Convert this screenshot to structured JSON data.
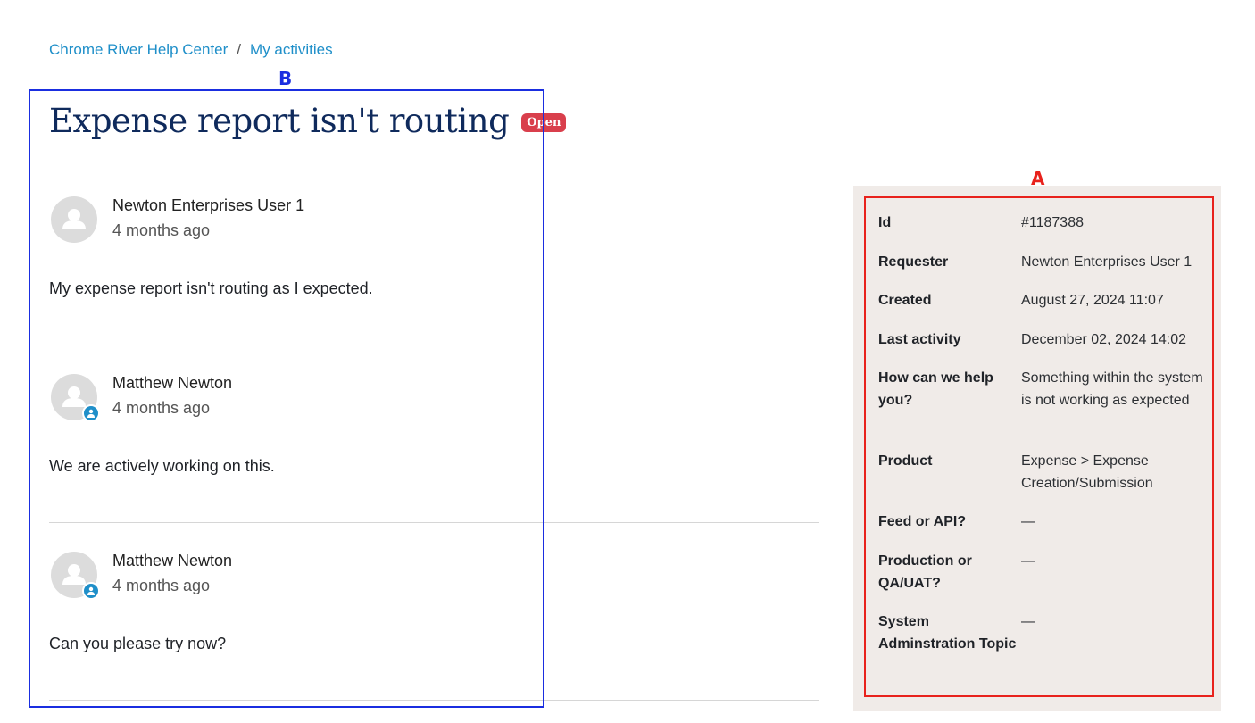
{
  "breadcrumb": {
    "home": "Chrome River Help Center",
    "separator": "/",
    "current": "My activities"
  },
  "annotations": {
    "a_label": "A",
    "b_label": "B",
    "a_color": "#e8221c",
    "b_color": "#1a2ee0"
  },
  "request": {
    "title": "Expense report isn't routing",
    "status": "Open",
    "status_color": "#d93f4c"
  },
  "comments": [
    {
      "author": "Newton Enterprises User 1",
      "time": "4 months ago",
      "body": "My expense report isn't routing as I expected.",
      "is_agent": false
    },
    {
      "author": "Matthew Newton",
      "time": "4 months ago",
      "body": "We are actively working on this.",
      "is_agent": true
    },
    {
      "author": "Matthew Newton",
      "time": "4 months ago",
      "body": "Can you please try now?",
      "is_agent": true
    }
  ],
  "details": [
    {
      "label": "Id",
      "value": "#1187388"
    },
    {
      "label": "Requester",
      "value": "Newton Enterprises User 1"
    },
    {
      "label": "Created",
      "value": "August 27, 2024 11:07"
    },
    {
      "label": "Last activity",
      "value": "December 02, 2024 14:02"
    },
    {
      "label": "How can we help you?",
      "value": "Something within the system is not working as expected"
    },
    {
      "label": "Product",
      "value": "Expense > Expense Creation/Submission"
    },
    {
      "label": "Feed or API?",
      "value": "—"
    },
    {
      "label": "Production or QA/UAT?",
      "value": "—"
    },
    {
      "label": "System Adminstration Topic",
      "value": "—"
    }
  ],
  "colors": {
    "link": "#1f8fc9",
    "title": "#0f2a5c",
    "sidebar_bg": "#f0ebe8"
  },
  "icons": {
    "avatar": "user-avatar-icon",
    "agent": "agent-badge-icon"
  }
}
